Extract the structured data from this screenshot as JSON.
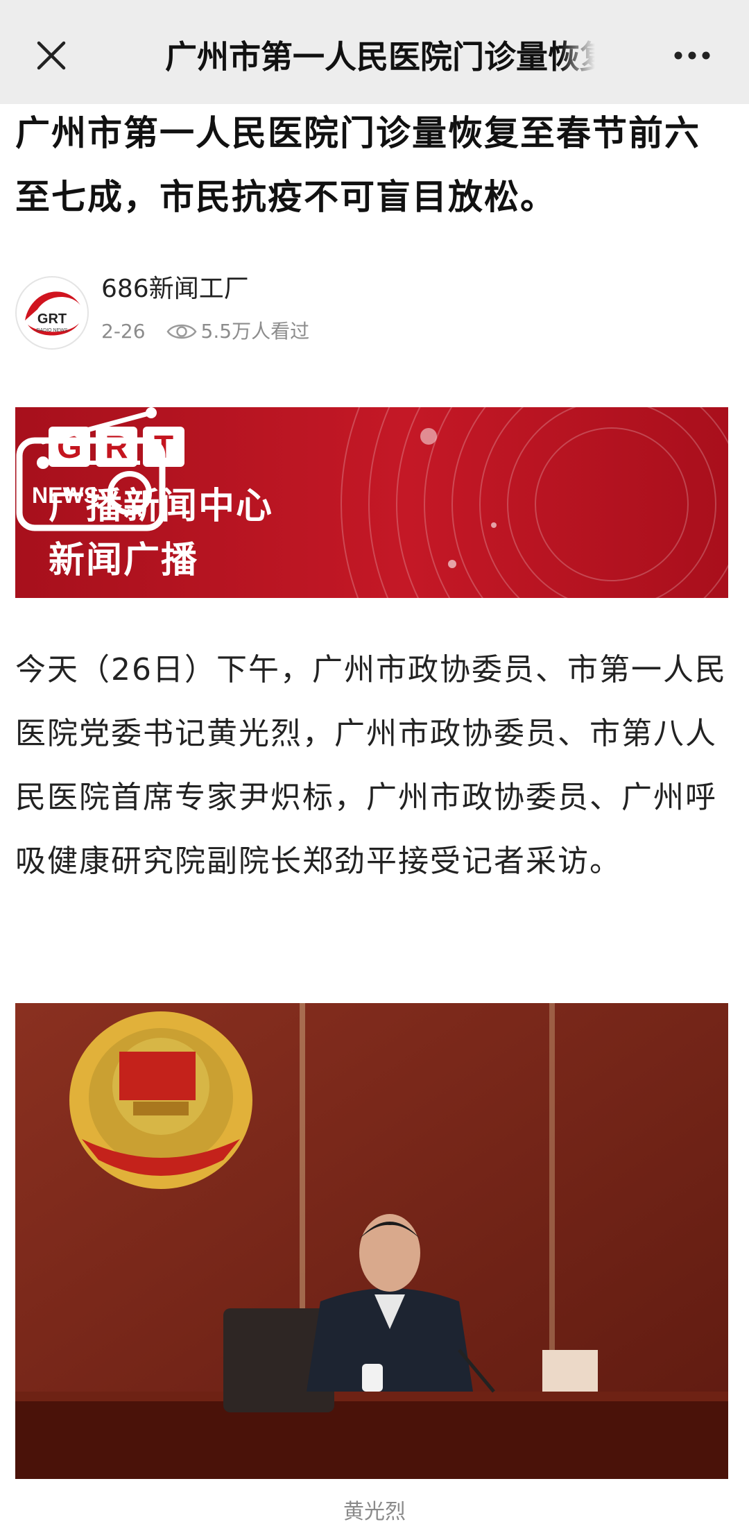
{
  "navbar": {
    "title": "广州市第一人民医院门诊量恢复至春节前六至七成，市民抗疫不可盲目放松。",
    "close_icon": "close-icon",
    "more_icon": "more-dots-icon"
  },
  "article": {
    "title": "广州市第一人民医院门诊量恢复至春节前六至七成，市民抗疫不可盲目放松。",
    "author": {
      "name": "686新闻工厂",
      "avatar_text": "GRT",
      "avatar_subtext": "RADIO NEWS",
      "date": "2-26",
      "views": "5.5万人看过"
    },
    "banner": {
      "letters": [
        "G",
        "R",
        "T"
      ],
      "line1": "广播新闻中心",
      "line2": "新闻广播",
      "radio_label": "NEWS"
    },
    "paragraph": "今天（26日）下午，广州市政协委员、市第一人民医院党委书记黄光烈，广州市政协委员、市第八人民医院首席专家尹炽标，广州市政协委员、广州呼吸健康研究院副院长郑劲平接受记者采访。",
    "photo_caption": "黄光烈"
  },
  "colors": {
    "navbar_bg": "#ededed",
    "banner_red": "#c41826",
    "meta_gray": "#8c8c8c"
  }
}
